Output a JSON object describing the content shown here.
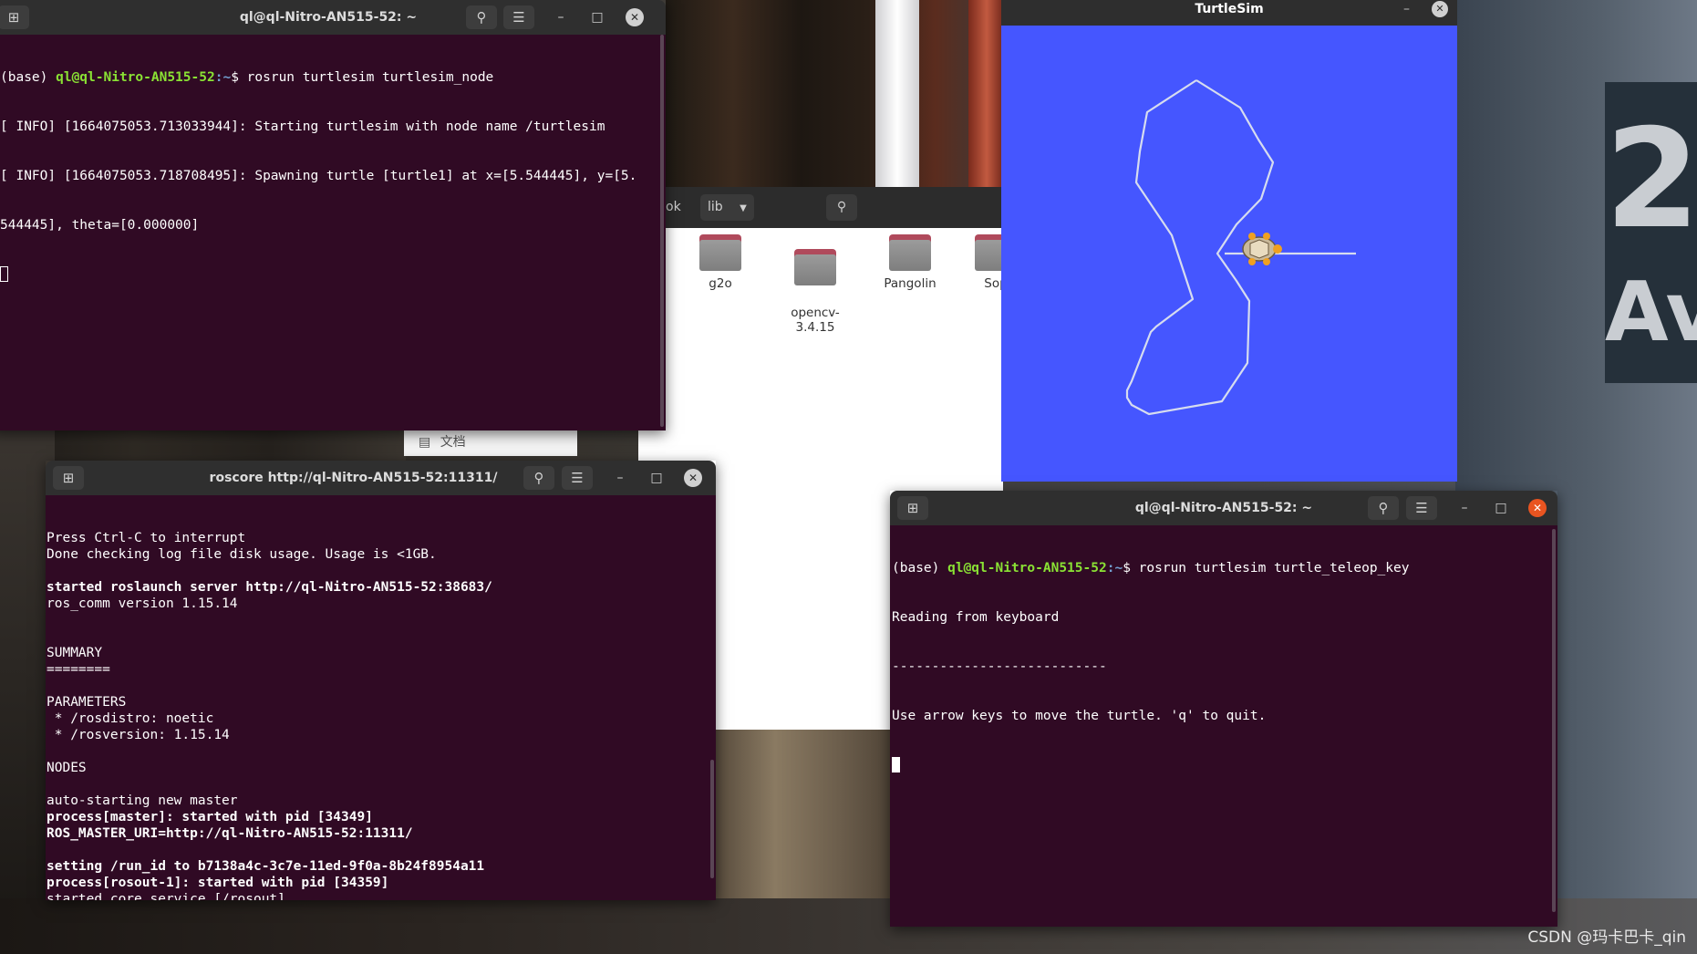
{
  "desktop": {
    "sign_number": "2",
    "sign_text": "Av",
    "watermark": "CSDN @玛卡巴卡_qin"
  },
  "term_turtlesim": {
    "title": "ql@ql-Nitro-AN515-52: ~",
    "prompt_env": "(base) ",
    "prompt_user": "ql@ql-Nitro-AN515-52",
    "prompt_path": ":~",
    "prompt_symbol": "$ ",
    "command": "rosrun turtlesim turtlesim_node",
    "lines": [
      "[ INFO] [1664075053.713033944]: Starting turtlesim with node name /turtlesim",
      "[ INFO] [1664075053.718708495]: Spawning turtle [turtle1] at x=[5.544445], y=[5.",
      "544445], theta=[0.000000]"
    ]
  },
  "file_manager": {
    "crumb_prev": "ok",
    "crumb_current": "lib",
    "folders": [
      "g2o",
      "opencv-\n3.4.15",
      "Pangolin",
      "Sop"
    ],
    "sidebar_item": "文档"
  },
  "turtlesim": {
    "title": "TurtleSim",
    "accent": "#4556ff"
  },
  "term_roscore": {
    "title": "roscore http://ql-Nitro-AN515-52:11311/",
    "lines": [
      {
        "t": "Press Ctrl-C to interrupt",
        "b": false
      },
      {
        "t": "Done checking log file disk usage. Usage is <1GB.",
        "b": false
      },
      {
        "t": "",
        "b": false
      },
      {
        "t": "started roslaunch server http://ql-Nitro-AN515-52:38683/",
        "b": true
      },
      {
        "t": "ros_comm version 1.15.14",
        "b": false
      },
      {
        "t": "",
        "b": false
      },
      {
        "t": "",
        "b": false
      },
      {
        "t": "SUMMARY",
        "b": false
      },
      {
        "t": "========",
        "b": false
      },
      {
        "t": "",
        "b": false
      },
      {
        "t": "PARAMETERS",
        "b": false
      },
      {
        "t": " * /rosdistro: noetic",
        "b": false
      },
      {
        "t": " * /rosversion: 1.15.14",
        "b": false
      },
      {
        "t": "",
        "b": false
      },
      {
        "t": "NODES",
        "b": false
      },
      {
        "t": "",
        "b": false
      },
      {
        "t": "auto-starting new master",
        "b": false
      },
      {
        "t": "process[master]: started with pid [34349]",
        "b": true
      },
      {
        "t": "ROS_MASTER_URI=http://ql-Nitro-AN515-52:11311/",
        "b": true
      },
      {
        "t": "",
        "b": false
      },
      {
        "t": "setting /run_id to b7138a4c-3c7e-11ed-9f0a-8b24f8954a11",
        "b": true
      },
      {
        "t": "process[rosout-1]: started with pid [34359]",
        "b": true
      },
      {
        "t": "started core service [/rosout]",
        "b": false
      }
    ]
  },
  "term_teleop": {
    "title": "ql@ql-Nitro-AN515-52: ~",
    "prompt_env": "(base) ",
    "prompt_user": "ql@ql-Nitro-AN515-52",
    "prompt_path": ":~",
    "prompt_symbol": "$ ",
    "command": "rosrun turtlesim turtle_teleop_key",
    "lines": [
      "Reading from keyboard",
      "---------------------------",
      "Use arrow keys to move the turtle. 'q' to quit."
    ]
  },
  "colors": {
    "terminal_bg": "#300a24",
    "prompt_user": "#8ae234",
    "prompt_path": "#729fcf",
    "close_active": "#e95420"
  }
}
